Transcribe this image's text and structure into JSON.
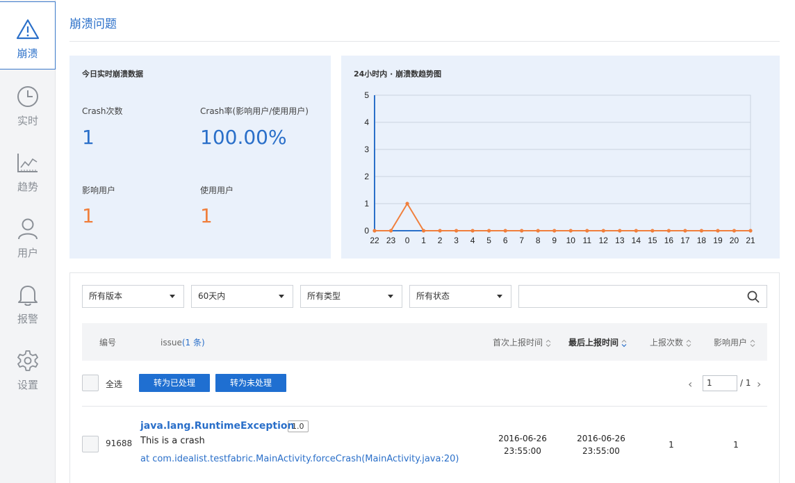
{
  "sidebar": {
    "items": [
      {
        "label": "崩溃",
        "icon": "warning-triangle-icon",
        "active": true
      },
      {
        "label": "实时",
        "icon": "clock-icon"
      },
      {
        "label": "趋势",
        "icon": "trend-chart-icon"
      },
      {
        "label": "用户",
        "icon": "user-icon"
      },
      {
        "label": "报警",
        "icon": "bell-icon"
      },
      {
        "label": "设置",
        "icon": "gear-icon"
      }
    ]
  },
  "header": {
    "title": "崩溃问题"
  },
  "stats": {
    "title": "今日实时崩溃数据",
    "crash_count_label": "Crash次数",
    "crash_count_value": "1",
    "crash_rate_label": "Crash率(影响用户/使用用户)",
    "crash_rate_value": "100.00%",
    "affected_users_label": "影响用户",
    "affected_users_value": "1",
    "active_users_label": "使用用户",
    "active_users_value": "1"
  },
  "chart_data": {
    "type": "line",
    "title": "24小时内 · 崩溃数趋势图",
    "categories": [
      "22",
      "23",
      "0",
      "1",
      "2",
      "3",
      "4",
      "5",
      "6",
      "7",
      "8",
      "9",
      "10",
      "11",
      "12",
      "13",
      "14",
      "15",
      "16",
      "17",
      "18",
      "19",
      "20",
      "21"
    ],
    "series": [
      {
        "values": [
          0,
          0,
          1,
          0,
          0,
          0,
          0,
          0,
          0,
          0,
          0,
          0,
          0,
          0,
          0,
          0,
          0,
          0,
          0,
          0,
          0,
          0,
          0,
          0
        ]
      }
    ],
    "ylim": [
      0,
      5
    ],
    "yticks": [
      0,
      1,
      2,
      3,
      4,
      5
    ],
    "grid": true,
    "colors": {
      "line": "#f07f3c",
      "axis": "#2a6fc9",
      "grid": "#c9d3df"
    }
  },
  "filters": {
    "version": "所有版本",
    "time_range": "60天内",
    "type": "所有类型",
    "status": "所有状态",
    "search_value": ""
  },
  "table": {
    "columns": {
      "id": "编号",
      "issue": "issue",
      "issue_count": "(1 条)",
      "first_report": "首次上报时间",
      "last_report": "最后上报时间",
      "report_count": "上报次数",
      "affected_users": "影响用户"
    },
    "select_all": "全选",
    "mark_handled": "转为已处理",
    "mark_unhandled": "转为未处理",
    "pager": {
      "prev": "‹",
      "current": "1",
      "total": "/ 1",
      "next": "›"
    },
    "rows": [
      {
        "id": "91688",
        "exception": "java.lang.RuntimeException",
        "version": "1.0",
        "message": "This is a crash",
        "stack": "at com.idealist.testfabric.MainActivity.forceCrash(MainActivity.java:20)",
        "first_date": "2016-06-26",
        "first_time": "23:55:00",
        "last_date": "2016-06-26",
        "last_time": "23:55:00",
        "report_count": "1",
        "affected_users": "1"
      }
    ]
  },
  "colors": {
    "accent": "#2a6fc9",
    "orange": "#f07f3c",
    "button": "#1f6fd1",
    "panel": "#eaf1fb"
  }
}
